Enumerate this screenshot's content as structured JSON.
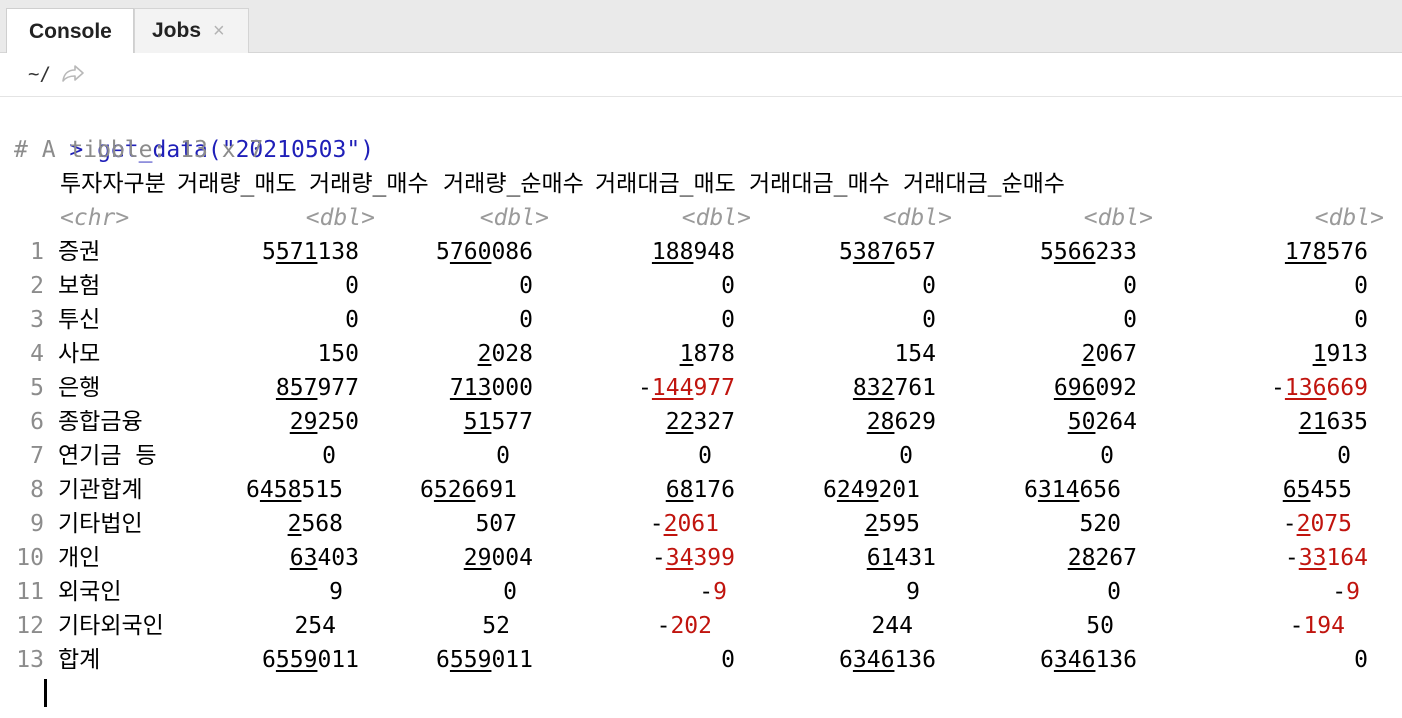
{
  "tabs": [
    {
      "label": "Console",
      "active": true
    },
    {
      "label": "Jobs",
      "active": false,
      "close": "×"
    }
  ],
  "toolbar": {
    "path": "~/"
  },
  "console": {
    "prompt": ">",
    "command": "get_data(\"20210503\")",
    "comment": "# A tibble: 13 x 7",
    "columns": [
      "투자자구분",
      "거래량_매도",
      "거래량_매수",
      "거래량_순매수",
      "거래대금_매도",
      "거래대금_매수",
      "거래대금_순매수"
    ],
    "types": [
      "<chr>",
      "<dbl>",
      "<dbl>",
      "<dbl>",
      "<dbl>",
      "<dbl>",
      "<dbl>"
    ],
    "rows": [
      {
        "n": "1",
        "label": "증권",
        "values": [
          "5571138",
          "5760086",
          "188948",
          "5387657",
          "5566233",
          "178576"
        ]
      },
      {
        "n": "2",
        "label": "보험",
        "values": [
          "0",
          "0",
          "0",
          "0",
          "0",
          "0"
        ]
      },
      {
        "n": "3",
        "label": "투신",
        "values": [
          "0",
          "0",
          "0",
          "0",
          "0",
          "0"
        ]
      },
      {
        "n": "4",
        "label": "사모",
        "values": [
          "150",
          "2028",
          "1878",
          "154",
          "2067",
          "1913"
        ]
      },
      {
        "n": "5",
        "label": "은행",
        "values": [
          "857977",
          "713000",
          "-144977",
          "832761",
          "696092",
          "-136669"
        ]
      },
      {
        "n": "6",
        "label": "종합금융",
        "values": [
          "29250",
          "51577",
          "22327",
          "28629",
          "50264",
          "21635"
        ]
      },
      {
        "n": "7",
        "label": "연기금 등",
        "values": [
          "0",
          "0",
          "0",
          "0",
          "0",
          "0"
        ]
      },
      {
        "n": "8",
        "label": "기관합계",
        "values": [
          "6458515",
          "6526691",
          "68176",
          "6249201",
          "6314656",
          "65455"
        ]
      },
      {
        "n": "9",
        "label": "기타법인",
        "values": [
          "2568",
          "507",
          "-2061",
          "2595",
          "520",
          "-2075"
        ]
      },
      {
        "n": "10",
        "label": "개인",
        "values": [
          "63403",
          "29004",
          "-34399",
          "61431",
          "28267",
          "-33164"
        ]
      },
      {
        "n": "11",
        "label": "외국인",
        "values": [
          "9",
          "0",
          "-9",
          "9",
          "0",
          "-9"
        ]
      },
      {
        "n": "12",
        "label": "기타외국인",
        "values": [
          "254",
          "52",
          "-202",
          "244",
          "50",
          "-194"
        ]
      },
      {
        "n": "13",
        "label": "합계",
        "values": [
          "6559011",
          "6559011",
          "0",
          "6346136",
          "6346136",
          "0"
        ]
      }
    ],
    "colors": {
      "prompt": "#1f1fb8",
      "negative": "#c0140e",
      "comment": "#8c8c8c"
    }
  }
}
